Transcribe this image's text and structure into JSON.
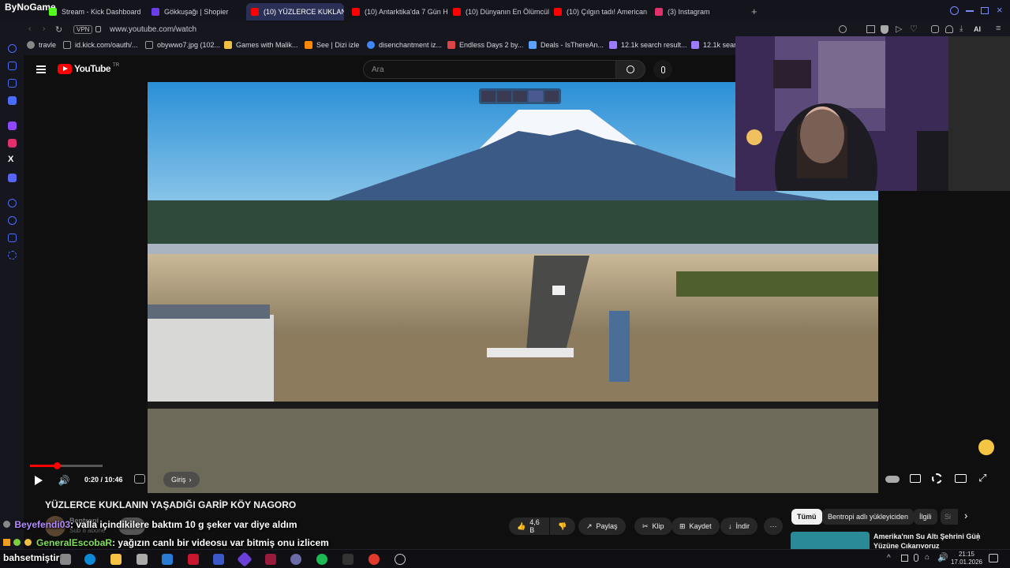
{
  "browser": {
    "brand": "ByNoGame",
    "tabs": [
      {
        "label": "Stream - Kick Dashboard",
        "color": "#53fc18"
      },
      {
        "label": "Gökkuşağı | Shopier",
        "color": "#6b3de8"
      },
      {
        "label": "(10) YÜZLERCE KUKLANI",
        "color": "#ff0000"
      },
      {
        "label": "(10) Antarktika'da 7 Gün H",
        "color": "#ff0000"
      },
      {
        "label": "(10) Dünyanın En Ölümcül",
        "color": "#ff0000"
      },
      {
        "label": "(10) Çılgın tadı! American",
        "color": "#ff0000"
      },
      {
        "label": "(3) Instagram",
        "color": "#e1306c"
      }
    ],
    "new_tab": "+",
    "vpn": "VPN",
    "url": "www.youtube.com/watch",
    "ai_label": "AI",
    "bookmarks": [
      "travle",
      "id.kick.com/oauth/...",
      "obywwo7.jpg (102...",
      "Games with Malik...",
      "See | Dizi izle",
      "disenchantment iz...",
      "Endless Days 2 by...",
      "Deals - IsThereAn...",
      "12.1k search result...",
      "12.1k searc"
    ]
  },
  "youtube": {
    "logo": "YouTube",
    "region": "TR",
    "search_placeholder": "Ara",
    "player": {
      "time": "0:20 / 10:46",
      "chapter": "Giriş",
      "progress": 0.031
    },
    "video_title": "YÜZLERCE KUKLANIN YAŞADIĞI GARİP KÖY NAGORO",
    "channel": "Bentropi",
    "subscribers": "Sub 8 abone",
    "actions": {
      "likes": "4,6 B",
      "share": "Paylaş",
      "clip": "Klip",
      "save": "Kaydet",
      "download": "İndir"
    },
    "filters": [
      "Tümü",
      "Bentropi adlı yükleyiciden",
      "İlgili",
      "Si"
    ],
    "recommended": {
      "title_line1": "Amerika'nın Su Altı Şehrini Gün",
      "title_line2": "Yüzüne Çıkarıyoruz"
    }
  },
  "chat": [
    {
      "user": "Beyefendi03",
      "message": ": valla içindikilere baktım 10 g şeker var diye aldım",
      "color": "#b48cff"
    },
    {
      "user": "GeneralEscobaR",
      "message": ": yağızın canlı bir videosu var bitmiş onu izlicem",
      "color": "#7fe05a"
    },
    {
      "user": "bahsetmiştir",
      "message": "",
      "color": "#ffffff"
    }
  ],
  "taskbar": {
    "time": "21:15",
    "date": "17.01.2026"
  }
}
